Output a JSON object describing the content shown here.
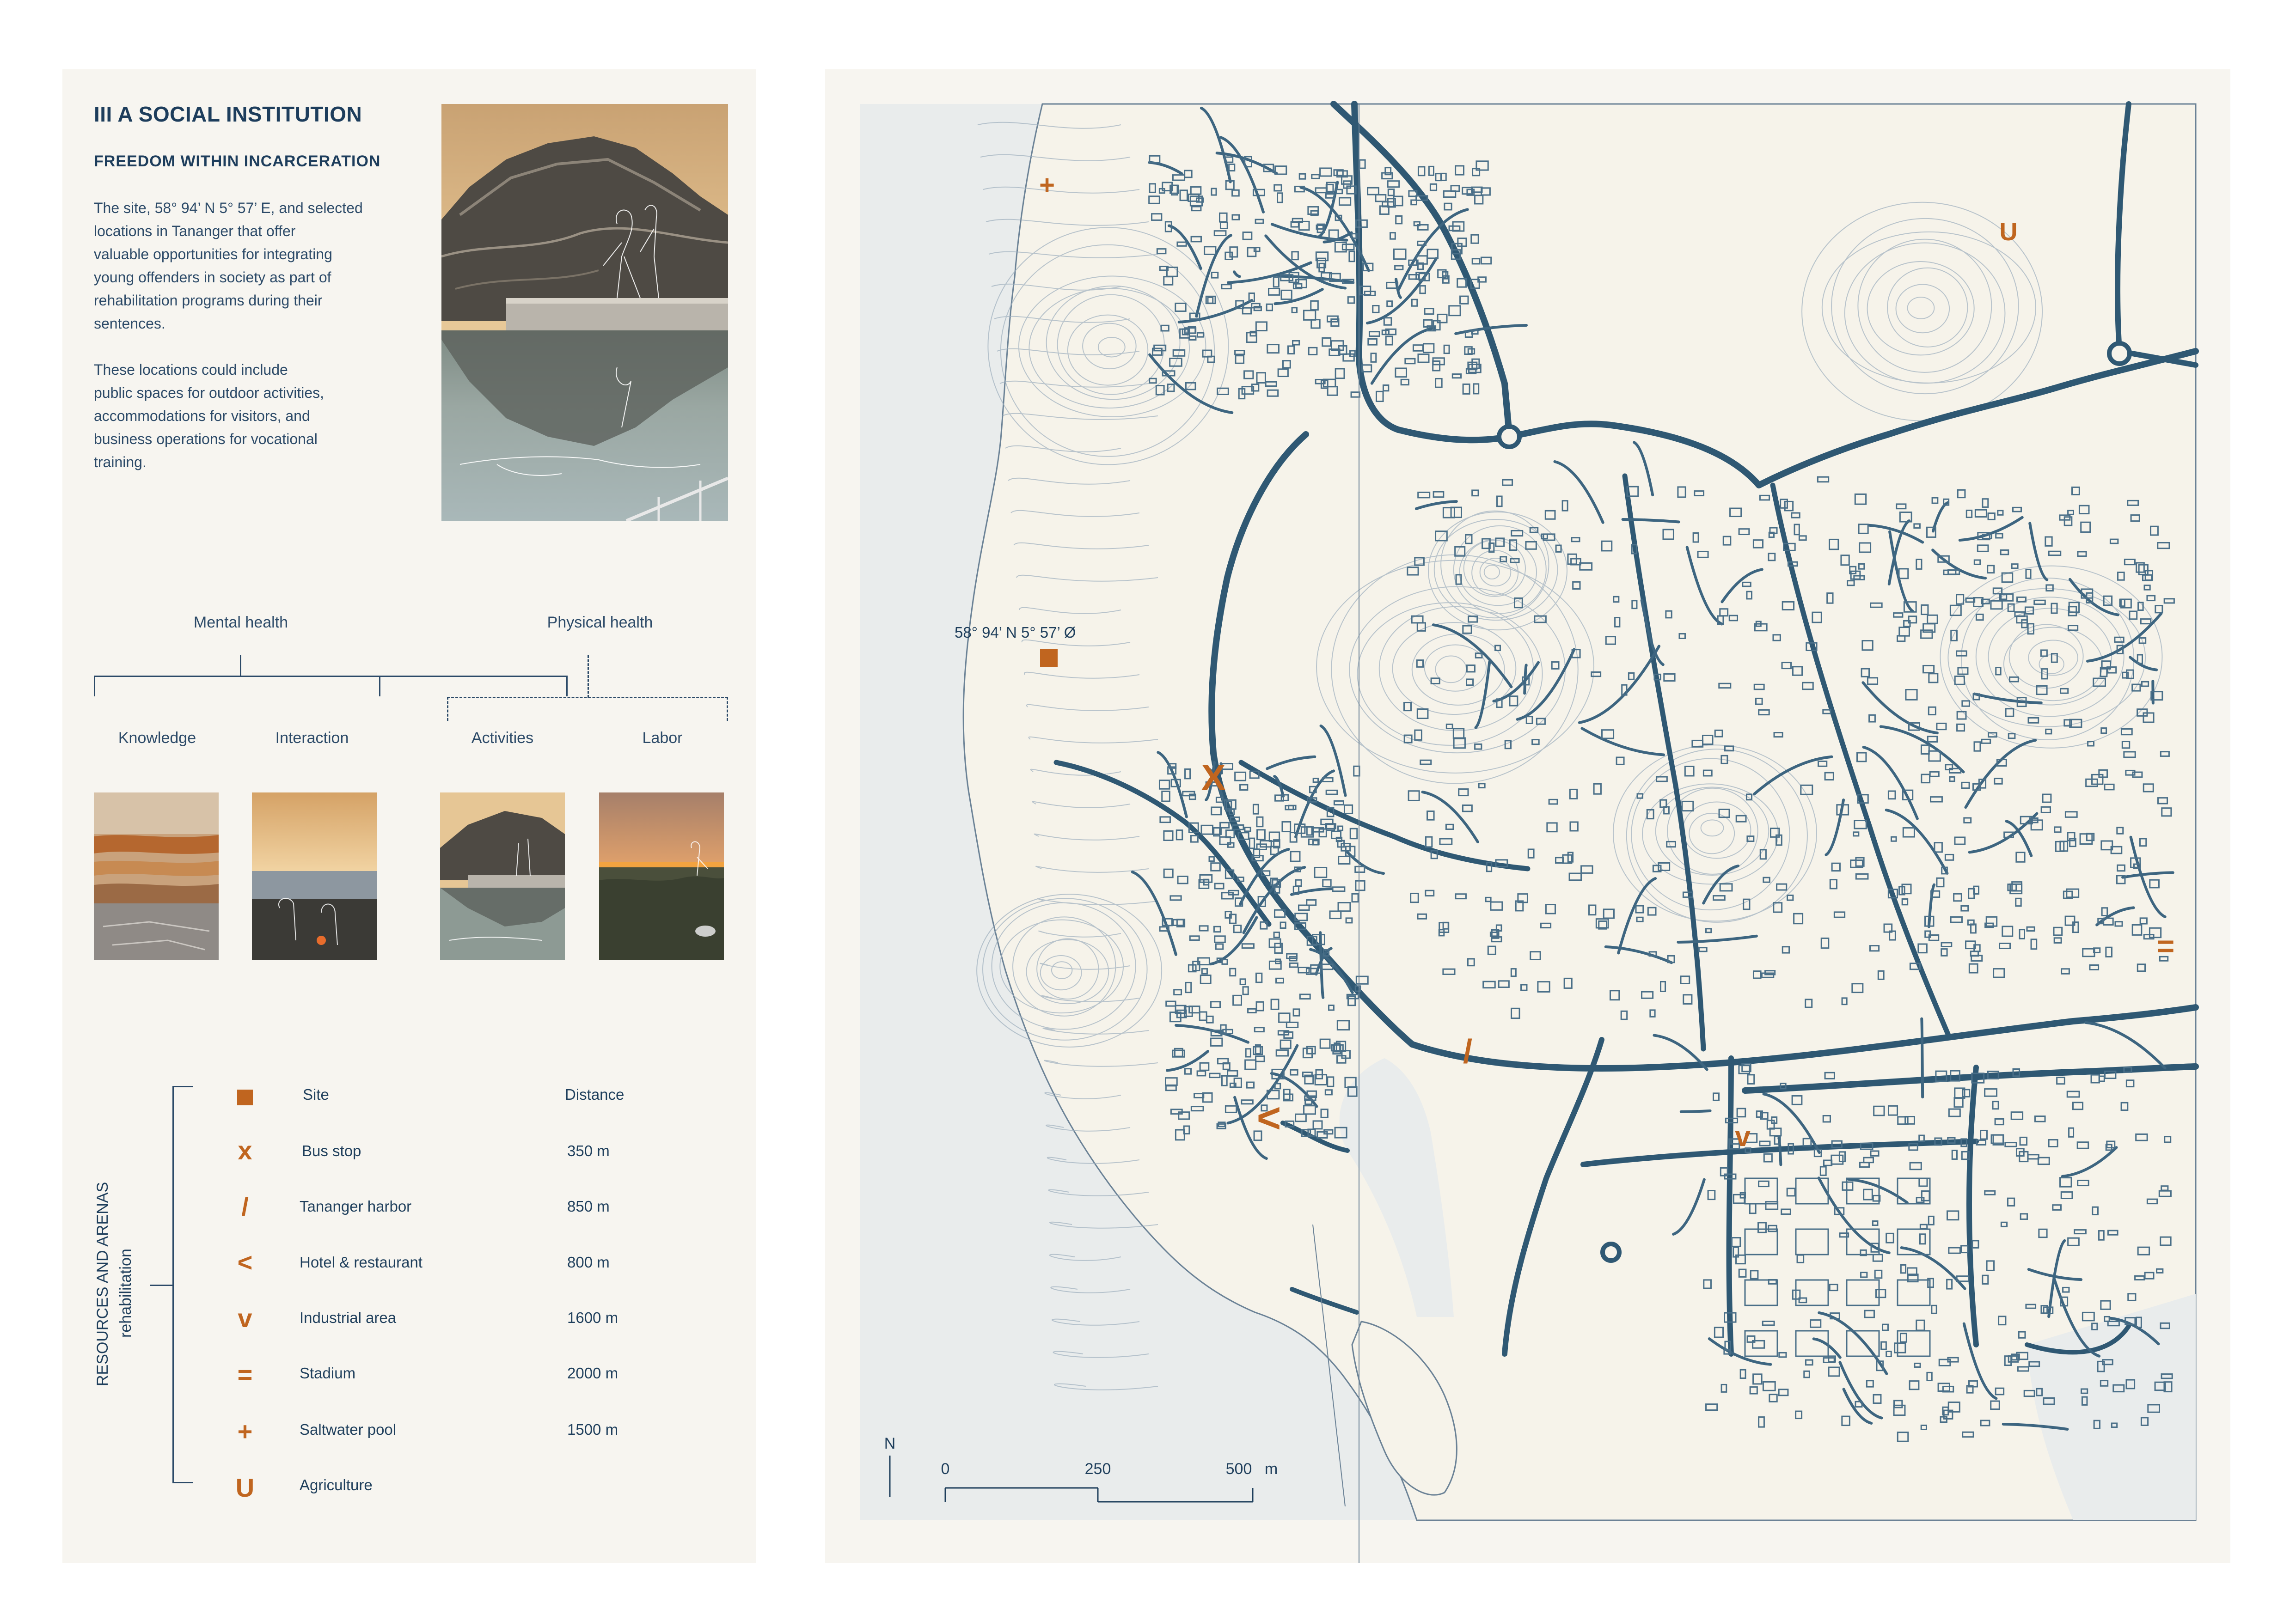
{
  "panel": {
    "title": "III A SOCIAL INSTITUTION",
    "subtitle": "FREEDOM WITHIN INCARCERATION",
    "paragraph1": [
      "The site, 58° 94’ N 5° 57’ E, and selected",
      "locations in Tananger that offer",
      "valuable opportunities for integrating",
      "young offenders in society as part of",
      "rehabilitation programs during their",
      "sentences."
    ],
    "paragraph2": [
      "These locations could include",
      "public spaces for outdoor activities,",
      "accommodations for visitors, and",
      "business operations for vocational",
      "training."
    ]
  },
  "tree": {
    "mental": "Mental health",
    "physical": "Physical health",
    "branches": [
      "Knowledge",
      "Interaction",
      "Activities",
      "Labor"
    ]
  },
  "legend": {
    "heading": "RESOURCES AND ARENAS",
    "subheading": "rehabilitation",
    "col_site": "Site",
    "col_distance": "Distance",
    "items": [
      {
        "symbol": "x",
        "name": "Bus stop",
        "distance": "350 m"
      },
      {
        "symbol": "/",
        "name": "Tananger harbor",
        "distance": "850 m"
      },
      {
        "symbol": "<",
        "name": "Hotel & restaurant",
        "distance": "800 m"
      },
      {
        "symbol": "v",
        "name": "Industrial area",
        "distance": "1600 m"
      },
      {
        "symbol": "=",
        "name": "Stadium",
        "distance": "2000 m"
      },
      {
        "symbol": "+",
        "name": "Saltwater pool",
        "distance": "1500 m"
      },
      {
        "symbol": "U",
        "name": "Agriculture",
        "distance": ""
      }
    ]
  },
  "map": {
    "site_coords": "58° 94’ N 5° 57’ Ø",
    "north": "N",
    "scale": {
      "t0": "0",
      "t1": "250",
      "t2": "500",
      "unit": "m"
    },
    "markers": [
      "+",
      "U",
      "X",
      "/",
      "<",
      "v",
      "="
    ]
  },
  "colors": {
    "accent": "#c0651f",
    "ink": "#1f3f5c",
    "road": "#2f5873",
    "land": "#f6f3ea",
    "sea": "#e9ecec"
  }
}
